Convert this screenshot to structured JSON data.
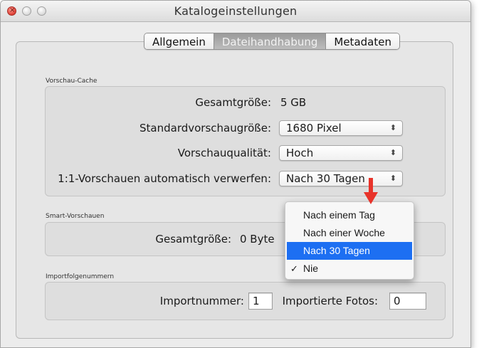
{
  "window": {
    "title": "Katalogeinstellungen"
  },
  "tabs": [
    {
      "label": "Allgemein",
      "active": false
    },
    {
      "label": "Dateihandhabung",
      "active": true
    },
    {
      "label": "Metadaten",
      "active": false
    }
  ],
  "preview_cache": {
    "group_label": "Vorschau-Cache",
    "total_size_label": "Gesamtgröße:",
    "total_size_value": "5 GB",
    "standard_size_label": "Standardvorschaugröße:",
    "standard_size_value": "1680 Pixel",
    "quality_label": "Vorschauqualität:",
    "quality_value": "Hoch",
    "discard_label": "1:1-Vorschauen automatisch verwerfen:",
    "discard_value": "Nach 30 Tagen"
  },
  "smart_previews": {
    "group_label": "Smart-Vorschauen",
    "total_size_label": "Gesamtgröße:",
    "total_size_value": "0 Byte"
  },
  "import_numbers": {
    "group_label": "Importfolgenummern",
    "import_number_label": "Importnummer:",
    "import_number_value": "1",
    "imported_photos_label": "Importierte Fotos:",
    "imported_photos_value": "0"
  },
  "discard_menu": {
    "options": [
      {
        "label": "Nach einem Tag",
        "checked": false,
        "highlighted": false
      },
      {
        "label": "Nach einer Woche",
        "checked": false,
        "highlighted": false
      },
      {
        "label": "Nach 30 Tagen",
        "checked": false,
        "highlighted": true
      },
      {
        "label": "Nie",
        "checked": true,
        "highlighted": false
      }
    ],
    "check_glyph": "✓"
  },
  "colors": {
    "highlight": "#1d6ff2",
    "annotation_arrow": "#e8332a"
  },
  "icons": {
    "popup_arrows": "updown-arrows-icon",
    "traffic_close": "close-icon"
  }
}
